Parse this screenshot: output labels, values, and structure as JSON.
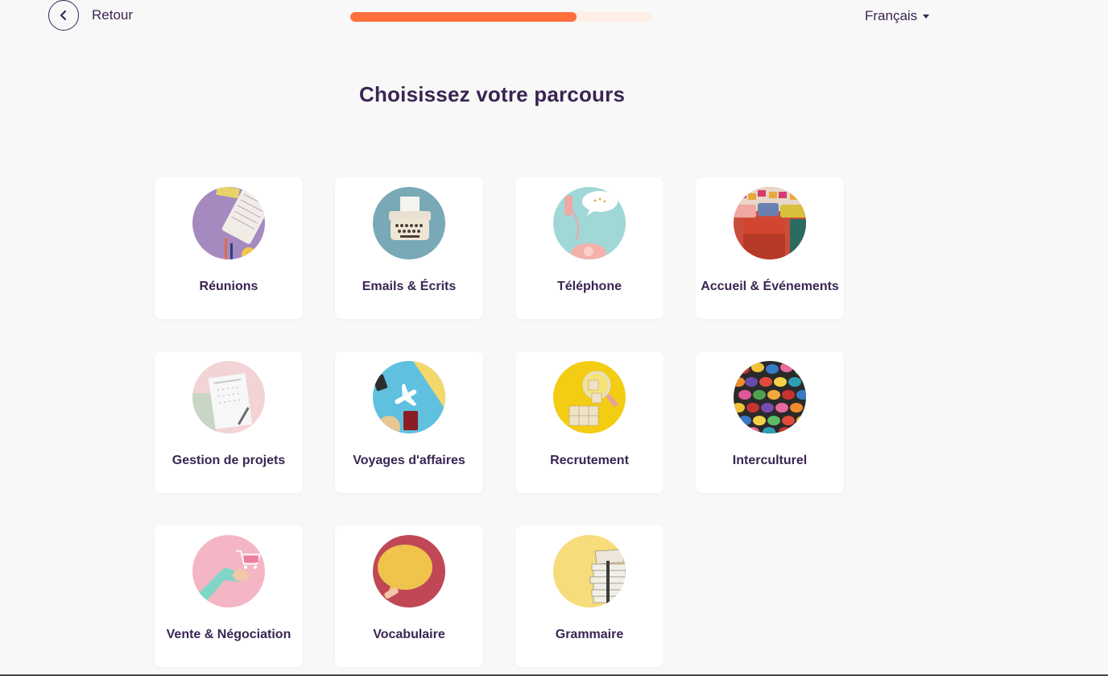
{
  "header": {
    "back_label": "Retour",
    "progress": 0.75,
    "language": "Français",
    "colors": {
      "accent": "#ff6f3c",
      "track": "#fdeee6",
      "text": "#3a2553"
    }
  },
  "main": {
    "title": "Choisissez votre parcours",
    "cards": [
      {
        "label": "Réunions",
        "icon": "meeting-notebook-icon"
      },
      {
        "label": "Emails & Écrits",
        "icon": "typewriter-icon"
      },
      {
        "label": "Téléphone",
        "icon": "phone-icon"
      },
      {
        "label": "Accueil & Événements",
        "icon": "event-chairs-icon"
      },
      {
        "label": "Gestion de projets",
        "icon": "notepad-icon"
      },
      {
        "label": "Voyages d'affaires",
        "icon": "airplane-icon"
      },
      {
        "label": "Recrutement",
        "icon": "magnifier-icon"
      },
      {
        "label": "Interculturel",
        "icon": "speech-bubbles-icon"
      },
      {
        "label": "Vente & Négociation",
        "icon": "shopping-cart-icon"
      },
      {
        "label": "Vocabulaire",
        "icon": "speech-bubble-icon"
      },
      {
        "label": "Grammaire",
        "icon": "books-icon"
      }
    ]
  }
}
